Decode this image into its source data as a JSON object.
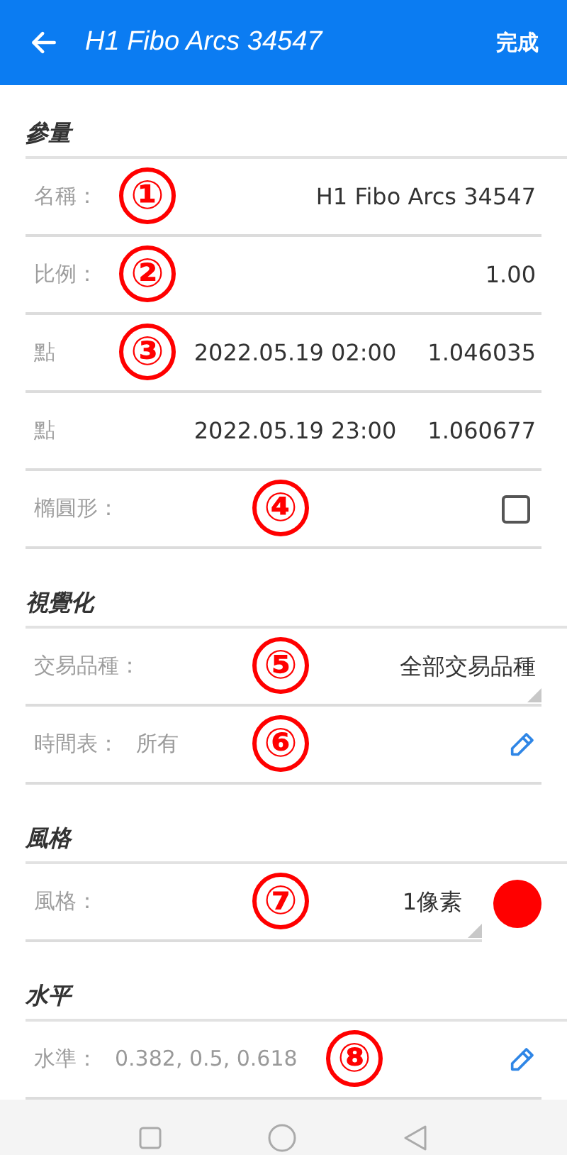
{
  "header": {
    "title": "H1 Fibo Arcs 34547",
    "done": "完成"
  },
  "sections": [
    {
      "title": "參量",
      "rows": [
        {
          "kind": "text",
          "label": "名稱：",
          "value": "H1 Fibo Arcs 34547",
          "marker": "①"
        },
        {
          "kind": "text",
          "label": "比例：",
          "value": "1.00",
          "marker": "②"
        },
        {
          "kind": "point",
          "label": "點",
          "date": "2022.05.19 02:00",
          "value": "1.046035",
          "marker": "③"
        },
        {
          "kind": "point",
          "label": "點",
          "date": "2022.05.19 23:00",
          "value": "1.060677"
        },
        {
          "kind": "checkbox",
          "label": "橢圓形：",
          "checked": false,
          "marker": "④"
        }
      ]
    },
    {
      "title": "視覺化",
      "rows": [
        {
          "kind": "dropdown",
          "label": "交易品種：",
          "value": "全部交易品種",
          "marker": "⑤"
        },
        {
          "kind": "edit",
          "label": "時間表：",
          "value": "所有",
          "marker": "⑥"
        }
      ]
    },
    {
      "title": "風格",
      "rows": [
        {
          "kind": "style",
          "label": "風格：",
          "value": "1像素",
          "color": "#ff0000",
          "marker": "⑦"
        }
      ]
    },
    {
      "title": "水平",
      "rows": [
        {
          "kind": "edit",
          "label": "水準：",
          "value": "0.382, 0.5, 0.618",
          "marker": "⑧"
        }
      ]
    }
  ]
}
